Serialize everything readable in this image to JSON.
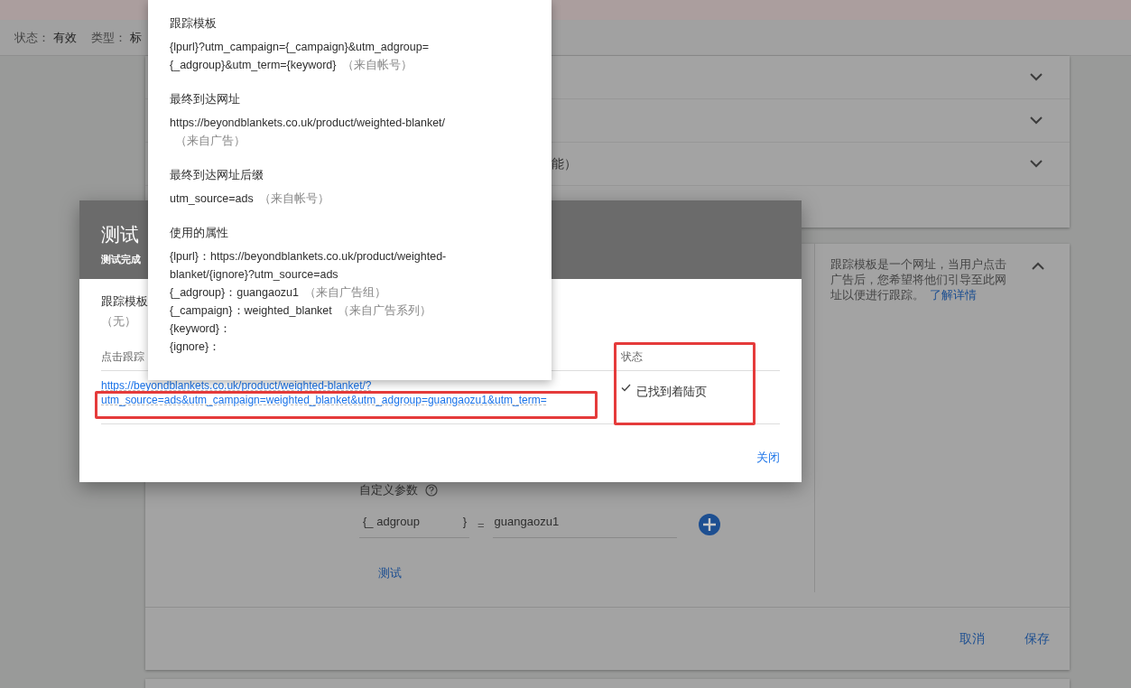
{
  "status_line": [
    {
      "label": "状态：",
      "value": "有效"
    },
    {
      "label": "类型：",
      "value": "标"
    }
  ],
  "sections": [
    {
      "expanded": false
    },
    {
      "expanded": false
    },
    {
      "text": "能）",
      "expanded": false
    }
  ],
  "tracking_card": {
    "expanded": true,
    "custom_params_label": "自定义参数",
    "key_prefix": "{_",
    "key": "adgroup",
    "key_suffix": "}",
    "equals": "=",
    "value": "guangaozu1",
    "test_link": "测试",
    "help_text": "跟踪模板是一个网址，当用户点击广告后，您希望将他们引导至此网址以便进行跟踪。",
    "help_link": "了解详情",
    "buttons": [
      "取消",
      "保存"
    ]
  },
  "dialog": {
    "title": "测试",
    "subtitle": "测试完成",
    "template_label": "跟踪模板",
    "template_value": "（无）",
    "column_1": "点击跟踪",
    "status_header": "状态",
    "url_lines": [
      "https://beyondblankets.co.uk/product/weighted-blanket/?",
      "utm_source=ads&utm_campaign=weighted_blanket&utm_adgroup=guangaozu1&utm_term="
    ],
    "status": "已找到着陆页",
    "status_ok": true,
    "close": "关闭"
  },
  "popover": [
    {
      "heading": "跟踪模板",
      "lines": [
        {
          "text": "{lpurl}?utm_campaign={_campaign}&utm_adgroup={_adgroup}&utm_term={keyword}",
          "source": "（来自帐号）"
        }
      ]
    },
    {
      "heading": "最终到达网址",
      "lines": [
        {
          "text": "https://beyondblankets.co.uk/product/weighted-blanket/",
          "source": "（来自广告）"
        }
      ]
    },
    {
      "heading": "最终到达网址后缀",
      "lines": [
        {
          "text": "utm_source=ads",
          "source": "（来自帐号）"
        }
      ]
    },
    {
      "heading": "使用的属性",
      "lines": [
        {
          "text": "{lpurl}：https://beyondblankets.co.uk/product/weighted-blanket/{ignore}?utm_source=ads"
        },
        {
          "text": "{_adgroup}：guangaozu1",
          "source": "（来自广告组）"
        },
        {
          "text": "{_campaign}：weighted_blanket",
          "source": "（来自广告系列）"
        },
        {
          "text": "{keyword}："
        },
        {
          "text": "{ignore}："
        }
      ]
    }
  ]
}
